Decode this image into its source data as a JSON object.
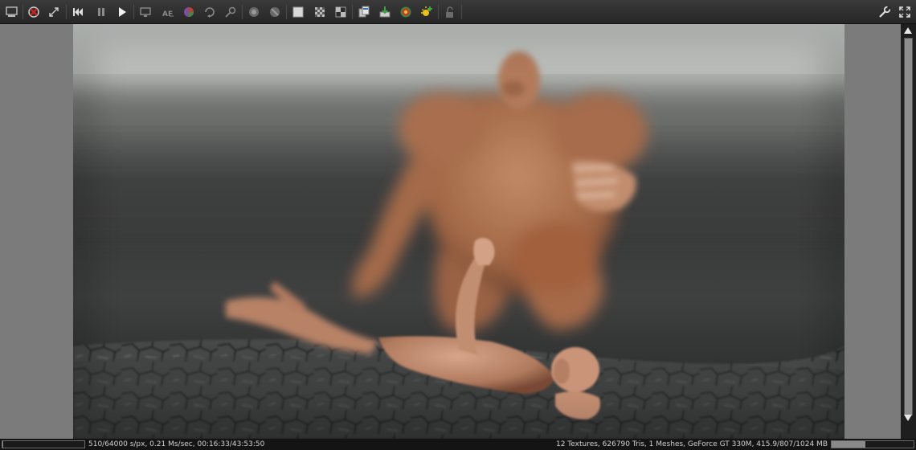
{
  "toolbar": {
    "left_icons": [
      "screenshot-icon",
      "cancel-render-icon",
      "resize-icon",
      "restart-icon",
      "pause-icon",
      "play-icon",
      "viewport-icon",
      "autofocus-icon",
      "color-picker-icon",
      "camera-rotate-icon",
      "pick-icon",
      "render-region-icon",
      "render-region-cancel-icon",
      "alpha-white-icon",
      "alpha-checker-icon",
      "alpha-black-icon",
      "copy-icon",
      "import-icon",
      "material-icon",
      "light-icon",
      "lock-icon"
    ],
    "right_icons": [
      "settings-wrench-icon",
      "fullscreen-icon"
    ]
  },
  "viewport": {
    "background_color": "#7b7b7b",
    "render_image": "rendered-scene"
  },
  "status": {
    "left_text": "510/64000 s/px, 0.21 Ms/sec, 00:16:33/43:53:50",
    "right_text": "12 Textures, 626790 Tris, 1 Meshes, GeForce GT 330M, 415.9/807/1024 MB",
    "render_progress": 0.008,
    "memory_usage": 0.41
  },
  "colors": {
    "toolbar_bg": "#2e2e2e",
    "status_bg": "#141414",
    "accent_red": "#c02020",
    "accent_yellow": "#e8c020"
  }
}
